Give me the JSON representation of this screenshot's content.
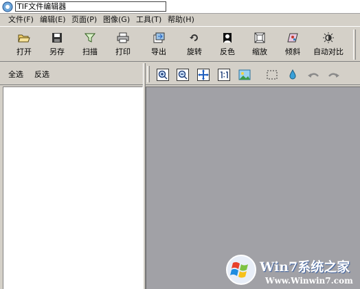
{
  "window": {
    "title": "TIF文件编辑器"
  },
  "menu": [
    "文件(F)",
    "编辑(E)",
    "页面(P)",
    "图像(G)",
    "工具(T)",
    "帮助(H)"
  ],
  "toolbar": [
    {
      "label": "打开",
      "icon": "open-folder-icon"
    },
    {
      "label": "另存",
      "icon": "save-disk-icon"
    },
    {
      "label": "扫描",
      "icon": "scan-icon"
    },
    {
      "label": "打印",
      "icon": "printer-icon"
    },
    {
      "label": "导出",
      "icon": "export-icon"
    },
    {
      "label": "旋转",
      "icon": "rotate-icon"
    },
    {
      "label": "反色",
      "icon": "invert-color-icon"
    },
    {
      "label": "缩放",
      "icon": "resize-icon"
    },
    {
      "label": "倾斜",
      "icon": "skew-icon"
    },
    {
      "label": "自动对比",
      "icon": "auto-contrast-icon"
    }
  ],
  "left_panel": {
    "select_all": "全选",
    "invert_selection": "反选"
  },
  "view_toolbar": [
    "zoom-in-icon",
    "zoom-out-icon",
    "fit-window-icon",
    "actual-size-icon",
    "fit-image-icon",
    "select-rect-icon",
    "eyedropper-icon",
    "undo-icon",
    "redo-icon"
  ],
  "watermark": {
    "brand": "Win7系统之家",
    "url": "Www.Winwin7.com"
  },
  "colors": {
    "canvas_bg": "#a1a1a6",
    "chrome_bg": "#d4d0c8",
    "accent_blue": "#1f5fbf"
  }
}
